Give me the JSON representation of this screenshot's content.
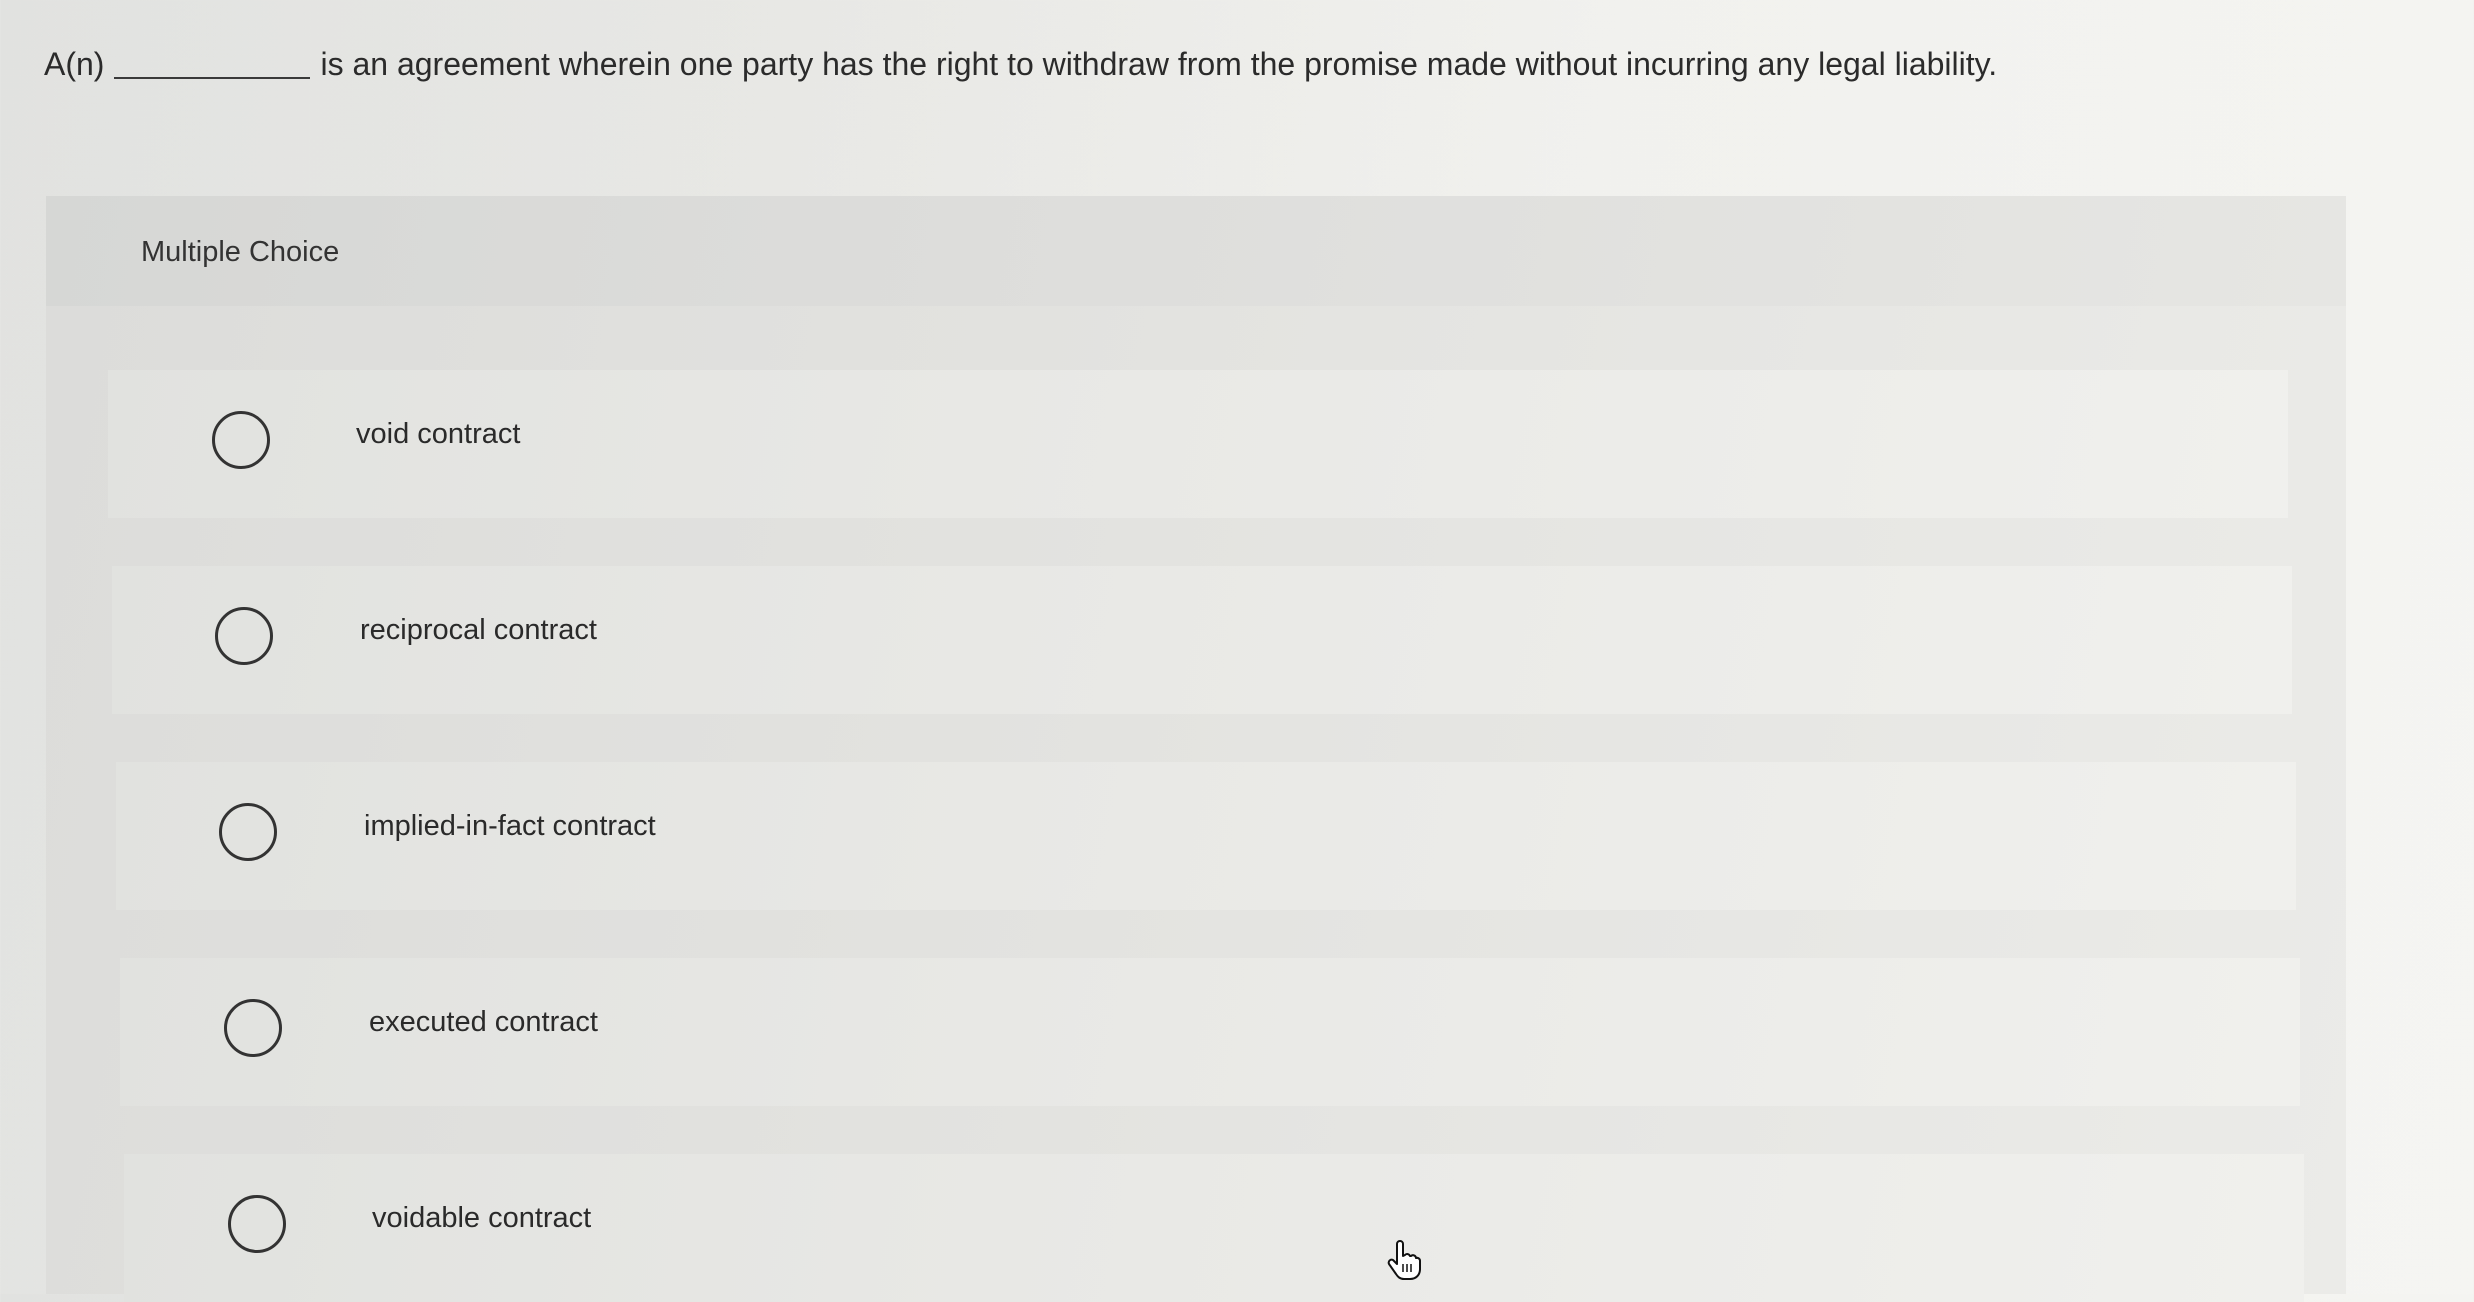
{
  "question": {
    "prefix": "A(n)",
    "text": "is an agreement wherein one party has the right to withdraw from the promise made without incurring any legal liability."
  },
  "panel": {
    "label": "Multiple Choice"
  },
  "options": [
    {
      "label": "void contract"
    },
    {
      "label": "reciprocal contract"
    },
    {
      "label": "implied-in-fact contract"
    },
    {
      "label": "executed contract"
    },
    {
      "label": "voidable contract"
    }
  ]
}
